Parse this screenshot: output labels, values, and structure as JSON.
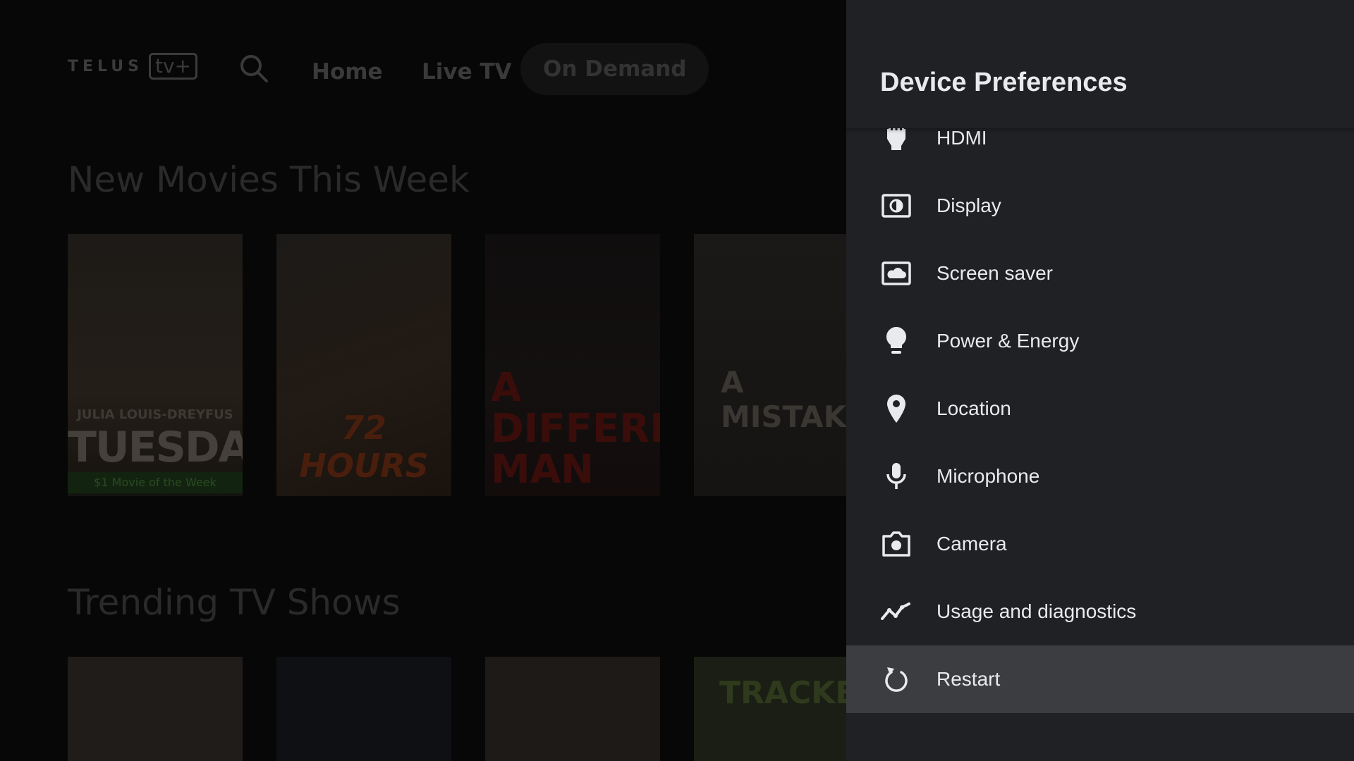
{
  "background_app": {
    "logo_wordmark": "TELUS",
    "logo_badge": "tv+",
    "nav": {
      "search_icon": "search-icon",
      "home": "Home",
      "live_tv": "Live TV",
      "on_demand": "On Demand"
    },
    "rows": [
      {
        "title": "New Movies This Week",
        "posters": [
          {
            "top_line": "JULIA LOUIS-DREYFUS",
            "title": "TUESDAY",
            "ribbon": "$1 Movie of the Week"
          },
          {
            "title": "72 HOURS"
          },
          {
            "title": "A DIFFERENT MAN"
          },
          {
            "title": "A MISTAKE"
          }
        ]
      },
      {
        "title": "Trending TV Shows",
        "posters": [
          {
            "title": ""
          },
          {
            "title": ""
          },
          {
            "title": ""
          },
          {
            "title": "TRACKER"
          }
        ]
      }
    ]
  },
  "panel": {
    "title": "Device Preferences",
    "items": [
      {
        "label": "HDMI",
        "icon": "hdmi-icon"
      },
      {
        "label": "Display",
        "icon": "display-icon"
      },
      {
        "label": "Screen saver",
        "icon": "screen-saver-icon"
      },
      {
        "label": "Power & Energy",
        "icon": "power-energy-icon"
      },
      {
        "label": "Location",
        "icon": "location-icon"
      },
      {
        "label": "Microphone",
        "icon": "microphone-icon"
      },
      {
        "label": "Camera",
        "icon": "camera-icon"
      },
      {
        "label": "Usage and diagnostics",
        "icon": "usage-diagnostics-icon"
      },
      {
        "label": "Restart",
        "icon": "restart-icon",
        "focused": true
      }
    ]
  },
  "colors": {
    "panel_bg": "#202124",
    "focused_item_bg": "#3c3d40",
    "text": "#e8eaed"
  }
}
